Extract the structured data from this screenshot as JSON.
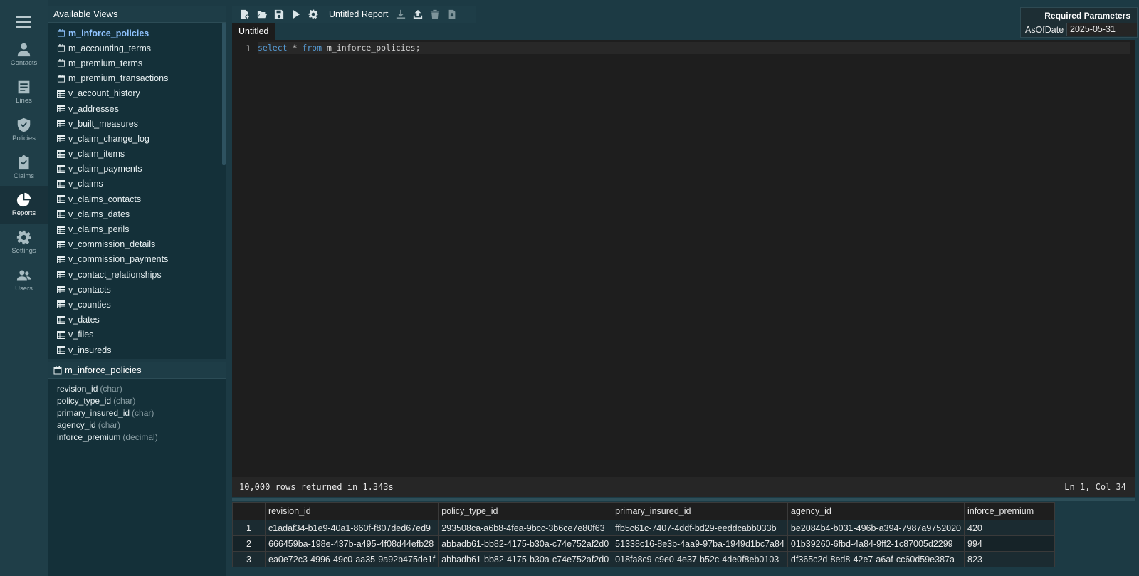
{
  "nav": {
    "items": [
      {
        "label": "Contacts",
        "icon": "contact-icon"
      },
      {
        "label": "Lines",
        "icon": "lines-icon"
      },
      {
        "label": "Policies",
        "icon": "shield-icon"
      },
      {
        "label": "Claims",
        "icon": "clipboard-icon"
      },
      {
        "label": "Reports",
        "icon": "pie-chart-icon",
        "active": true
      },
      {
        "label": "Settings",
        "icon": "gear-icon"
      },
      {
        "label": "Users",
        "icon": "users-icon"
      }
    ]
  },
  "views": {
    "header": "Available Views",
    "items": [
      {
        "label": "m_inforce_policies",
        "icon": "calendar-icon",
        "active": true
      },
      {
        "label": "m_accounting_terms",
        "icon": "calendar-icon"
      },
      {
        "label": "m_premium_terms",
        "icon": "calendar-icon"
      },
      {
        "label": "m_premium_transactions",
        "icon": "calendar-icon"
      },
      {
        "label": "v_account_history",
        "icon": "table-icon"
      },
      {
        "label": "v_addresses",
        "icon": "table-icon"
      },
      {
        "label": "v_built_measures",
        "icon": "table-icon"
      },
      {
        "label": "v_claim_change_log",
        "icon": "table-icon"
      },
      {
        "label": "v_claim_items",
        "icon": "table-icon"
      },
      {
        "label": "v_claim_payments",
        "icon": "table-icon"
      },
      {
        "label": "v_claims",
        "icon": "table-icon"
      },
      {
        "label": "v_claims_contacts",
        "icon": "table-icon"
      },
      {
        "label": "v_claims_dates",
        "icon": "table-icon"
      },
      {
        "label": "v_claims_perils",
        "icon": "table-icon"
      },
      {
        "label": "v_commission_details",
        "icon": "table-icon"
      },
      {
        "label": "v_commission_payments",
        "icon": "table-icon"
      },
      {
        "label": "v_contact_relationships",
        "icon": "table-icon"
      },
      {
        "label": "v_contacts",
        "icon": "table-icon"
      },
      {
        "label": "v_counties",
        "icon": "table-icon"
      },
      {
        "label": "v_dates",
        "icon": "table-icon"
      },
      {
        "label": "v_files",
        "icon": "table-icon"
      },
      {
        "label": "v_insureds",
        "icon": "table-icon"
      }
    ]
  },
  "details": {
    "header": "m_inforce_policies",
    "fields": [
      {
        "name": "revision_id",
        "type": "(char)"
      },
      {
        "name": "policy_type_id",
        "type": "(char)"
      },
      {
        "name": "primary_insured_id",
        "type": "(char)"
      },
      {
        "name": "agency_id",
        "type": "(char)"
      },
      {
        "name": "inforce_premium",
        "type": "(decimal)"
      }
    ]
  },
  "toolbar": {
    "title": "Untitled Report",
    "buttons": [
      "new-report-icon",
      "open-folder-icon",
      "save-icon",
      "run-icon",
      "settings-gear-icon",
      "download-icon",
      "upload-icon",
      "delete-icon",
      "export-file-icon"
    ]
  },
  "tabs": [
    {
      "label": "Untitled"
    }
  ],
  "editor": {
    "line_number": "1",
    "code": {
      "kw1": "select",
      "star": " * ",
      "kw2": "from",
      "rest": " m_inforce_policies;"
    }
  },
  "status": {
    "left": "10,000 rows returned in 1.343s",
    "right": "Ln 1, Col 34"
  },
  "params": {
    "title": "Required Parameters",
    "label": "AsOfDate",
    "value": "2025-05-31"
  },
  "results": {
    "columns": [
      "",
      "revision_id",
      "policy_type_id",
      "primary_insured_id",
      "agency_id",
      "inforce_premium"
    ],
    "rows": [
      [
        "1",
        "c1adaf34-b1e9-40a1-860f-f807ded67ed9",
        "293508ca-a6b8-4fea-9bcc-3b6ce7e80f63",
        "ffb5c61c-7407-4ddf-bd29-eeddcabb033b",
        "be2084b4-b031-496b-a394-7987a9752020",
        "420"
      ],
      [
        "2",
        "666459ba-198e-437b-a495-4f08d44efb28",
        "abbadb61-bb82-4175-b30a-c74e752af2d0",
        "51338c16-8e3b-4aa9-97ba-1949d1bc7a84",
        "01b39260-6fbd-4a84-9ff2-1c87005d2299",
        "994"
      ],
      [
        "3",
        "ea0e72c3-4996-49c0-aa35-9a92b475de1f",
        "abbadb61-bb82-4175-b30a-c74e752af2d0",
        "018fa8c9-c9e0-4e37-b52c-4de0f8eb0103",
        "df365c2d-8ed8-42e7-a6af-cc60d59e387a",
        "823"
      ]
    ]
  }
}
